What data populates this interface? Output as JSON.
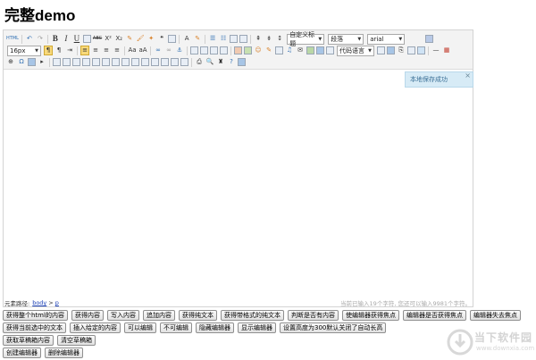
{
  "page": {
    "title": "完整demo"
  },
  "toolbar": {
    "html_label": "HTML",
    "font_style_value": "自定义标题",
    "paragraph_value": "段落",
    "font_family_value": "arial",
    "font_size_value": "16px",
    "code_lang_value": "代码语言",
    "bold": "B",
    "italic": "I",
    "underline": "U",
    "strike": "ABC",
    "superscript": "X²",
    "subscript": "X₂",
    "quote": "❝",
    "font_color": "A",
    "icons_row1": [
      "source-icon",
      "undo-icon",
      "redo-icon",
      "bold-icon",
      "italic-icon",
      "underline-icon",
      "fontborder-icon",
      "strikethrough-icon",
      "superscript-icon",
      "subscript-icon",
      "removeformat-icon",
      "formatmatch-icon",
      "autotypeset-icon",
      "blockquote-icon",
      "pasteplain-icon",
      "forecolor-icon",
      "backcolor-icon",
      "insertorderedlist-icon",
      "insertunorderedlist-icon",
      "selectall-icon",
      "cleardoc-icon",
      "rowspacingtop-icon",
      "rowspacingbottom-icon",
      "lineheight-icon",
      "fullscreen-icon"
    ],
    "icons_row2": [
      "directionalityltr-icon",
      "directionalityrtl-icon",
      "indent-icon",
      "justifyleft-icon",
      "justifycenter-icon",
      "justifyright-icon",
      "justifyjustify-icon",
      "touppercase-icon",
      "tolowercase-icon",
      "link-icon",
      "unlink-icon",
      "anchor-icon",
      "imagenone-icon",
      "imageleft-icon",
      "imageright-icon",
      "imagecenter-icon",
      "simpleupload-icon",
      "insertimage-icon",
      "emotion-icon",
      "scrawl-icon",
      "insertvideo-icon",
      "music-icon",
      "attachment-icon",
      "map-icon",
      "gmap-icon",
      "insertframe-icon",
      "insertcode-icon",
      "webapp-icon",
      "pagebreak-icon",
      "template-icon",
      "background-icon",
      "horizontal-icon",
      "date-icon",
      "time-icon"
    ],
    "icons_row3": [
      "wordimage-icon",
      "spechars-icon",
      "snapscreen-icon",
      "inserttable-icon",
      "deletetable-icon",
      "insertparagraphbeforetable-icon",
      "insertrow-icon",
      "deleterow-icon",
      "insertcol-icon",
      "deletecol-icon",
      "mergecells-icon",
      "mergeright-icon",
      "mergedown-icon",
      "splittocells-icon",
      "splittorows-icon",
      "splittocols-icon",
      "charts-icon",
      "print-icon",
      "preview-icon",
      "searchreplace-icon",
      "help-icon",
      "drafts-icon"
    ]
  },
  "tip": {
    "text": "本地保存成功",
    "close": "×"
  },
  "status": {
    "path_label": "元素路径:",
    "path_body": "body",
    "path_sep": ">",
    "path_p": "p",
    "word_count": "当前已输入19个字符, 您还可以输入9981个字符。"
  },
  "buttons": {
    "row1": [
      "获得整个html的内容",
      "获得内容",
      "写入内容",
      "追加内容",
      "获得纯文本",
      "获得带格式的纯文本",
      "判断是否有内容",
      "使编辑器获得焦点",
      "编辑器是否获得焦点",
      "编辑器失去焦点"
    ],
    "row2": [
      "获得当前选中的文本",
      "插入给定的内容",
      "可以编辑",
      "不可编辑",
      "隐藏编辑器",
      "显示编辑器",
      "设置高度为300默认关闭了自动长高"
    ],
    "row3": [
      "获取草稿箱内容",
      "清空草稿箱"
    ],
    "row4": [
      "创建编辑器",
      "删除编辑器"
    ]
  },
  "watermark": {
    "name": "当下软件园",
    "url": "www.downxia.com"
  }
}
